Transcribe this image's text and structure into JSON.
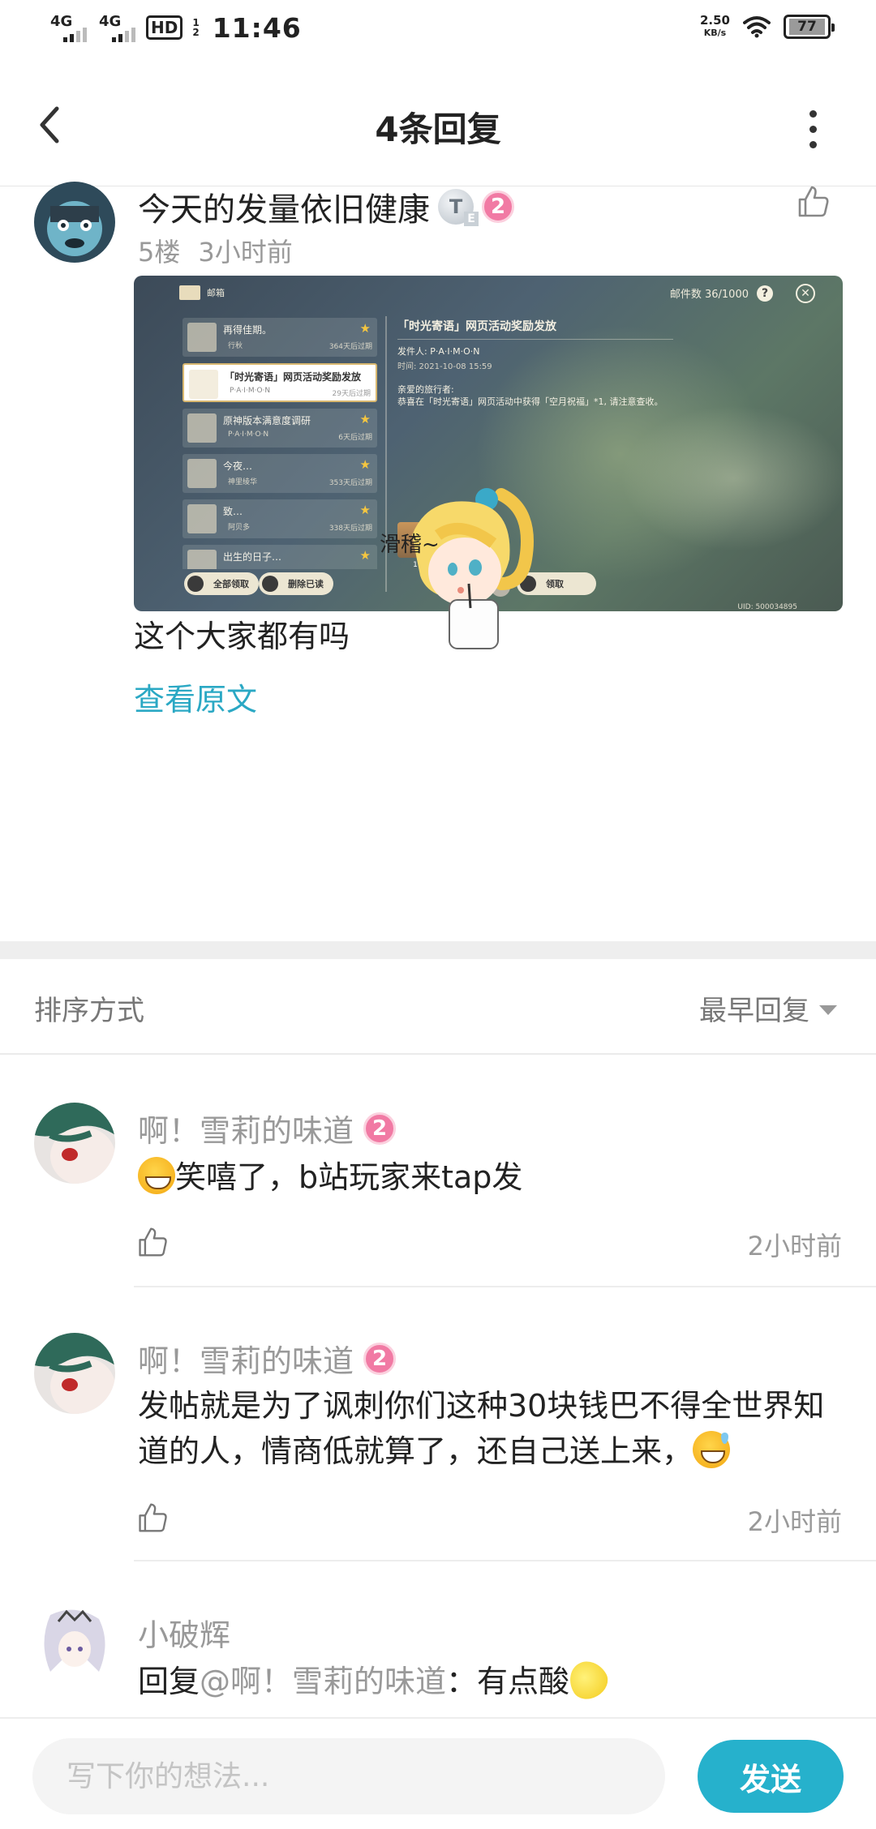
{
  "status_bar": {
    "network_1": "4G",
    "network_2": "4G",
    "hd_label": "HD",
    "hd_sub_top": "1",
    "hd_sub_bottom": "2",
    "time": "11:46",
    "speed_value": "2.50",
    "speed_unit": "KB/s",
    "battery": "77"
  },
  "header": {
    "title": "4条回复"
  },
  "post": {
    "author": "今天的发量依旧健康",
    "title_badge": "T",
    "level_badge": "2",
    "floor": "5楼",
    "time": "3小时前",
    "body": "这个大家都有吗",
    "view_original": "查看原文",
    "sticker_text": "滑稽~",
    "image": {
      "mailbox_label": "邮箱",
      "mail_count": "邮件数 36/1000",
      "mails": [
        {
          "title": "再得佳期。",
          "sender": "行秋",
          "expires": "364天后过期",
          "starred": true,
          "unread": true,
          "selected": false
        },
        {
          "title": "「时光寄语」网页活动奖励发放",
          "sender": "P·A·I·M·O·N",
          "expires": "29天后过期",
          "starred": false,
          "unread": true,
          "selected": true
        },
        {
          "title": "原神版本满意度调研",
          "sender": "P·A·I·M·O·N",
          "expires": "6天后过期",
          "starred": true,
          "unread": false,
          "selected": false
        },
        {
          "title": "今夜…",
          "sender": "神里绫华",
          "expires": "353天后过期",
          "starred": true,
          "unread": false,
          "selected": false
        },
        {
          "title": "致…",
          "sender": "阿贝多",
          "expires": "338天后过期",
          "starred": true,
          "unread": false,
          "selected": false
        },
        {
          "title": "出生的日子…",
          "sender": "",
          "expires": "",
          "starred": true,
          "unread": false,
          "selected": false
        }
      ],
      "detail_title": "「时光寄语」网页活动奖励发放",
      "detail_from": "发件人: P·A·I·M·O·N",
      "detail_date": "时间: 2021-10-08 15:59",
      "detail_greeting": "亲爱的旅行者:",
      "detail_body": "恭喜在「时光寄语」网页活动中获得「空月祝福」*1, 请注意查收。",
      "reward_count": "1",
      "btn_claim_all": "全部领取",
      "btn_delete_read": "删除已读",
      "btn_claim": "领取",
      "uid": "UID: 500034895"
    }
  },
  "sort": {
    "label": "排序方式",
    "value": "最早回复"
  },
  "replies": [
    {
      "author": "啊！雪莉的味道",
      "level_badge": "2",
      "content": "笑嘻了，b站玩家来tap发",
      "emoji": "grin-emoji",
      "time": "2小时前"
    },
    {
      "author": "啊！雪莉的味道",
      "level_badge": "2",
      "content": "发帖就是为了讽刺你们这种30块钱巴不得全世界知道的人，情商低就算了，还自己送上来，",
      "emoji": "sweat-smile-emoji",
      "time": "2小时前"
    },
    {
      "author": "小破辉",
      "content_prefix": "回复",
      "mention": "@啊！雪莉的味道",
      "content": "：有点酸",
      "emoji": "lemon-emoji"
    }
  ],
  "composer": {
    "placeholder": "写下你的想法...",
    "send_label": "发送"
  },
  "colors": {
    "accent": "#26b1cc",
    "link": "#2aa8c4",
    "level_badge": "#f17aa4",
    "meta_text": "#999999"
  }
}
